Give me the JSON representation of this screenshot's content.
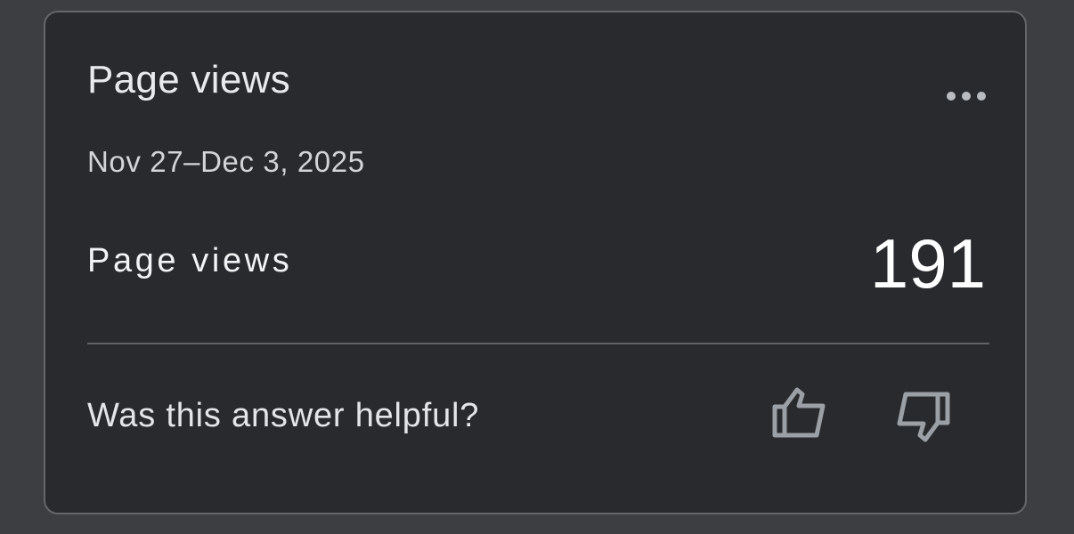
{
  "card": {
    "title": "Page views",
    "date_range": "Nov 27–Dec 3, 2025",
    "metric": {
      "label": "Page views",
      "value": "191"
    },
    "feedback": {
      "question": "Was this answer helpful?"
    }
  },
  "icons": {
    "more": "more-horizontal-icon",
    "thumb_up": "thumb-up-icon",
    "thumb_down": "thumb-down-icon"
  },
  "colors": {
    "background": "#3c3e41",
    "card_background": "#292a2d",
    "card_border": "#64666a",
    "text_primary": "#e8eaed",
    "icon": "#9aa0a6"
  }
}
